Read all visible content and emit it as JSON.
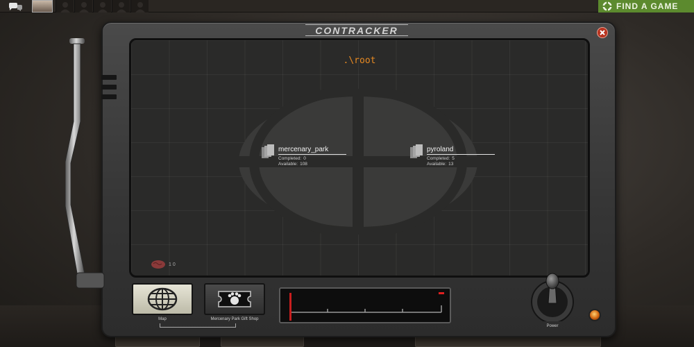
{
  "topbar": {
    "find_game_label": "FIND A GAME",
    "party_slots": 5
  },
  "contracker": {
    "title": "CONTRACKER",
    "path": ".\\root",
    "regions": [
      {
        "name": "mercenary_park",
        "completed_label": "Completed:",
        "completed": "0",
        "available_label": "Available:",
        "available": "108"
      },
      {
        "name": "pyroland",
        "completed_label": "Completed:",
        "completed": "5",
        "available_label": "Available:",
        "available": "13"
      }
    ],
    "reward_count": "1 0",
    "modes": [
      {
        "label": "Map",
        "icon": "globe-icon",
        "active": true
      },
      {
        "label": "Mercenary Park Gift Shop",
        "icon": "ticket-paw-icon",
        "active": false
      }
    ],
    "power_label": "Power"
  },
  "colors": {
    "path_title": "#e88a22",
    "find_game_bg": "#5c8a2e",
    "close_button": "#b8331f",
    "meter_needle": "#c81e1e"
  }
}
